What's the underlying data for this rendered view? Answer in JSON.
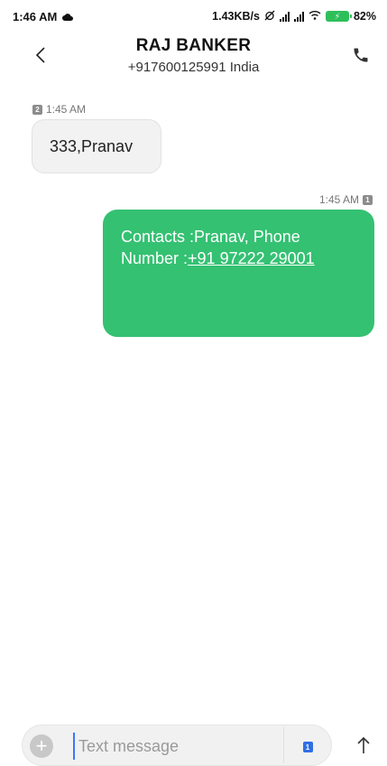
{
  "status_bar": {
    "time": "1:46 AM",
    "speed": "1.43KB/s",
    "battery": "82%"
  },
  "header": {
    "name": "RAJ BANKER",
    "subtitle": "+917600125991 India"
  },
  "messages": [
    {
      "direction": "incoming",
      "sim": "2",
      "time": "1:45 AM",
      "text": "333,Pranav"
    },
    {
      "direction": "outgoing",
      "sim": "1",
      "time": "1:45 AM",
      "text_prefix": "Contacts :Pranav, Phone Number :",
      "link_text": "+91 97222 29001"
    }
  ],
  "composer": {
    "placeholder": "Text message",
    "sim": "1"
  },
  "colors": {
    "outgoing_bubble": "#34c172",
    "incoming_bubble": "#f2f2f2",
    "sim_chip": "#2f6ee6"
  }
}
